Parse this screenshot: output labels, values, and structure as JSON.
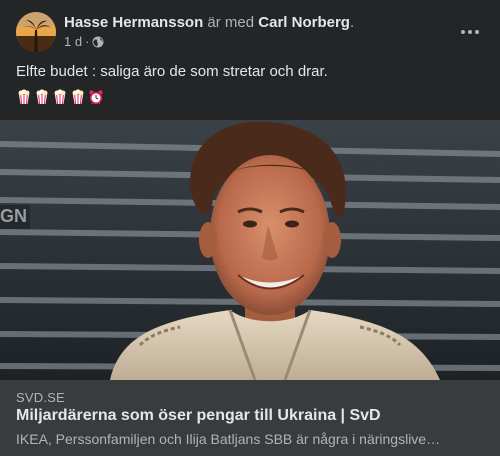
{
  "post": {
    "author": "Hasse Hermansson",
    "with_text": "är med",
    "tagged": "Carl Norberg",
    "period": ".",
    "time": "1 d",
    "dot": "·",
    "privacy_icon": "globe-icon",
    "more_icon": "more-options-icon",
    "message": "Elfte budet : saliga äro de som stretar och drar.",
    "emojis": [
      "popcorn",
      "popcorn",
      "popcorn",
      "popcorn",
      "alarm-clock"
    ]
  },
  "link_preview": {
    "domain": "SVD.SE",
    "title": "Miljardärerna som öser pengar till Ukraina | SvD",
    "description": "IKEA, Perssonfamiljen och Ilija Batljans SBB är några i näringslive…"
  },
  "colors": {
    "background": "#242526",
    "link_card": "#3a3b3c",
    "primary_text": "#e4e6eb",
    "secondary_text": "#b0b3b8"
  }
}
